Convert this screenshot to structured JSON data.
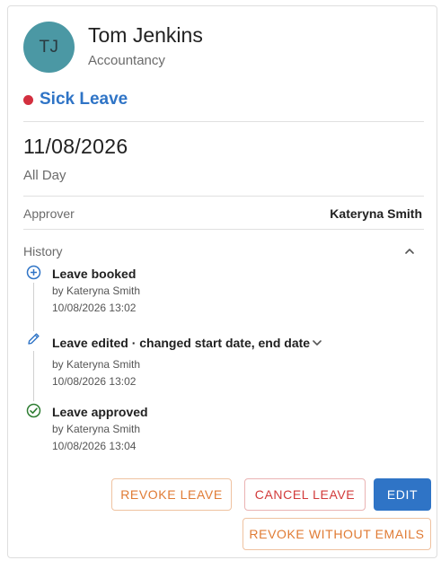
{
  "employee": {
    "initials": "TJ",
    "name": "Tom Jenkins",
    "department": "Accountancy"
  },
  "leave": {
    "type": "Sick Leave",
    "type_color": "#d32f3f",
    "date": "11/08/2026",
    "duration": "All Day"
  },
  "approver": {
    "label": "Approver",
    "name": "Kateryna Smith"
  },
  "history": {
    "label": "History",
    "events": [
      {
        "title": "Leave booked",
        "by": "by Kateryna Smith",
        "timestamp": "10/08/2026 13:02",
        "icon": "plus-circle-icon"
      },
      {
        "title": "Leave edited · changed start date, end date",
        "by": "by Kateryna Smith",
        "timestamp": "10/08/2026 13:02",
        "icon": "pencil-icon"
      },
      {
        "title": "Leave approved",
        "by": "by Kateryna Smith",
        "timestamp": "10/08/2026 13:04",
        "icon": "check-circle-icon"
      }
    ]
  },
  "actions": {
    "revoke": "REVOKE LEAVE",
    "cancel": "CANCEL LEAVE",
    "edit": "EDIT",
    "revoke_without_emails": "REVOKE WITHOUT EMAILS"
  },
  "colors": {
    "primary": "#2f74c6",
    "warning": "#e07b34",
    "danger": "#d23a3a",
    "success": "#2e7d32",
    "avatar": "#4b98a4"
  }
}
